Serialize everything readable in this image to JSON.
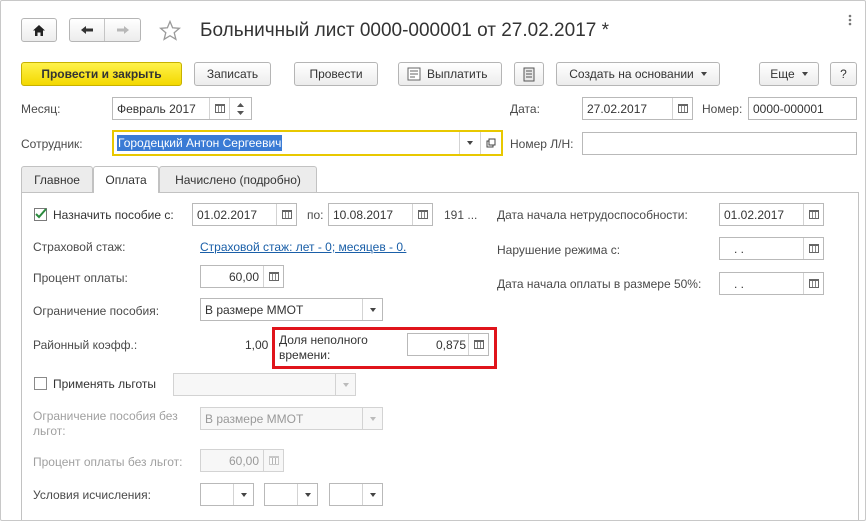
{
  "title": "Больничный лист 0000-000001 от 27.02.2017 *",
  "nav": {
    "home_icon": "home-icon",
    "back_icon": "arrow-left-icon",
    "forward_icon": "arrow-right-icon",
    "star_icon": "star-icon"
  },
  "toolbar": {
    "post_close": "Провести и закрыть",
    "save": "Записать",
    "post": "Провести",
    "pay": "Выплатить",
    "create_based": "Создать на основании",
    "more": "Еще",
    "help": "?"
  },
  "header": {
    "month_label": "Месяц:",
    "month_value": "Февраль 2017",
    "date_label": "Дата:",
    "date_value": "27.02.2017",
    "number_label": "Номер:",
    "number_value": "0000-000001",
    "employee_label": "Сотрудник:",
    "employee_value": "Городецкий Антон Сергеевич",
    "sick_number_label": "Номер Л/Н:",
    "sick_number_value": ""
  },
  "tabs": [
    "Главное",
    "Оплата",
    "Начислено (подробно)"
  ],
  "payment": {
    "assign_label": "Назначить пособие с:",
    "assign_checked": true,
    "from_date": "01.02.2017",
    "to_label": "по:",
    "to_date": "10.08.2017",
    "days_text": "191 ...",
    "insurance_label": "Страховой стаж:",
    "insurance_link": "Страховой стаж: лет - 0; месяцев - 0.",
    "percent_label": "Процент оплаты:",
    "percent_value": "60,00",
    "limit_label": "Ограничение пособия:",
    "limit_value": "В размере ММОТ",
    "district_label": "Районный коэфф.:",
    "district_value": "1,00",
    "parttime_label": "Доля неполного времени:",
    "parttime_value": "0,875",
    "benefits_label": "Применять льготы",
    "benefits_checked": false,
    "benefits_value": "",
    "limit_nobenefit_label": "Ограничение пособия без льгот:",
    "limit_nobenefit_value": "В размере ММОТ",
    "percent_nobenefit_label": "Процент оплаты без льгот:",
    "percent_nobenefit_value": "60,00",
    "conditions_label": "Условия исчисления:",
    "incapacity_start_label": "Дата начала нетрудоспособности:",
    "incapacity_start_value": "01.02.2017",
    "regime_violation_label": "Нарушение режима с:",
    "regime_violation_value": ".  .",
    "half_pay_label": "Дата начала оплаты в размере 50%:",
    "half_pay_value": ".  ."
  },
  "colors": {
    "primary_button": "#f3d800",
    "highlight_border": "#e0141b",
    "selection": "#3a7bd5",
    "link": "#1a5fa8",
    "focus_border": "#e8c800"
  }
}
